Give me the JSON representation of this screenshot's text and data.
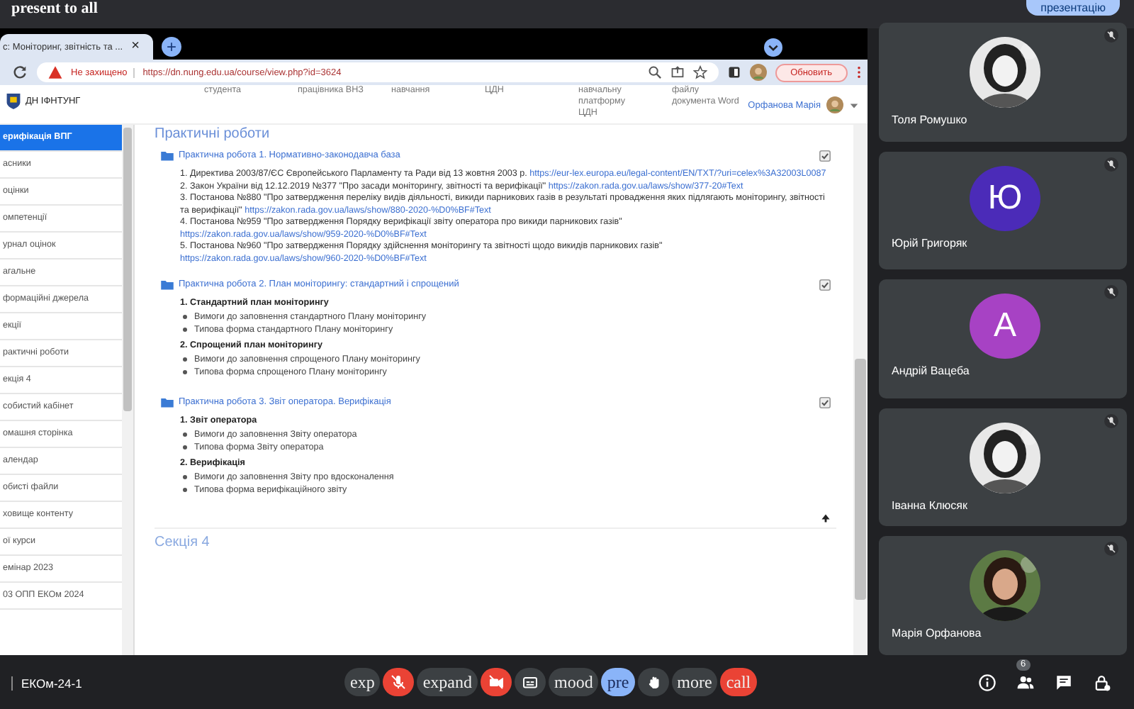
{
  "top_strip": {
    "text": "present to all",
    "button": "презентацію"
  },
  "browser": {
    "tab": {
      "title": "с: Моніторинг, звітність та ...",
      "close": "×"
    },
    "new_tab": "+",
    "security": "Не захищено",
    "url": "https://dn.nung.edu.ua/course/view.php?id=3624",
    "update_button": "Обновить"
  },
  "site": {
    "logo": "ДН ІФНТУНГ",
    "nav": [
      "студента",
      "працівника ВНЗ",
      "навчання",
      "ЦДН",
      "навчальну платформу ЦДН",
      "файлу документа Word"
    ],
    "user": "Орфанова Марія"
  },
  "sidebar": {
    "items": [
      {
        "label": "ерифікація ВПГ",
        "selected": true
      },
      {
        "label": "асники",
        "selected": false
      },
      {
        "label": "оцінки",
        "selected": false
      },
      {
        "label": "омпетенції",
        "selected": false
      },
      {
        "label": "урнал оцінок",
        "selected": false
      },
      {
        "label": "агальне",
        "selected": false
      },
      {
        "label": "формаційні джерела",
        "selected": false
      },
      {
        "label": "екції",
        "selected": false
      },
      {
        "label": "рактичні роботи",
        "selected": false
      },
      {
        "label": "екція 4",
        "selected": false
      },
      {
        "label": "собистий кабінет",
        "selected": false
      },
      {
        "label": "омашня сторінка",
        "selected": false
      },
      {
        "label": "алендар",
        "selected": false
      },
      {
        "label": "обисті файли",
        "selected": false
      },
      {
        "label": "ховище контенту",
        "selected": false
      },
      {
        "label": "ої курси",
        "selected": false
      },
      {
        "label": "емінар 2023",
        "selected": false
      },
      {
        "label": "03 ОПП ЕКОм 2024",
        "selected": false
      }
    ]
  },
  "content": {
    "section_title": "Практичні роботи",
    "activities": [
      {
        "title": "Практична робота 1. Нормативно-законодавча база",
        "checked": true,
        "kind": "links",
        "items": [
          {
            "text": "1. Директива 2003/87/ЄС Європейського Парламенту та Ради від 13 жовтня 2003 р.",
            "link": "https://eur-lex.europa.eu/legal-content/EN/TXT/?uri=celex%3A32003L0087"
          },
          {
            "text": "2. Закон України від 12.12.2019 №377 \"Про засади моніторингу, звітності та верифікації\"",
            "link": "https://zakon.rada.gov.ua/laws/show/377-20#Text"
          },
          {
            "text": "3. Постанова №880 \"Про затвердження переліку видів діяльності, викиди парникових газів в результаті провадження яких підлягають моніторингу, звітності та верифікації\"",
            "link": "https://zakon.rada.gov.ua/laws/show/880-2020-%D0%BF#Text"
          },
          {
            "text": "4. Постанова №959 \"Про затвердження Порядку верифікації звіту оператора про викиди парникових газів\"",
            "link": "https://zakon.rada.gov.ua/laws/show/959-2020-%D0%BF#Text"
          },
          {
            "text": "5. Постанова №960 \"Про затвердження Порядку здійснення моніторингу та звітності щодо викидів парникових газів\"",
            "link": "https://zakon.rada.gov.ua/laws/show/960-2020-%D0%BF#Text"
          }
        ]
      },
      {
        "title": "Практична робота 2. План моніторингу: стандартний і спрощений",
        "checked": true,
        "kind": "groups",
        "groups": [
          {
            "heading": "1. Стандартний план моніторингу",
            "bullets": [
              "Вимоги до заповнення стандартного Плану моніторингу",
              "Типова форма стандартного Плану моніторингу"
            ]
          },
          {
            "heading": "2. Спрощений план моніторингу",
            "bullets": [
              "Вимоги до заповнення спрощеного Плану моніторингу",
              "Типова форма спрощеного Плану моніторингу"
            ]
          }
        ]
      },
      {
        "title": "Практична робота 3. Звіт оператора. Верифікація",
        "checked": true,
        "kind": "groups",
        "groups": [
          {
            "heading": "1. Звіт оператора",
            "bullets": [
              "Вимоги до заповнення Звіту оператора",
              "Типова форма Звіту оператора"
            ]
          },
          {
            "heading": "2. Верифікація",
            "bullets": [
              "Вимоги до заповнення Звіту про вдосконалення",
              "Типова форма верифікаційного звіту"
            ]
          }
        ]
      }
    ],
    "next_section": "Секція 4"
  },
  "participants": [
    {
      "name": "Толя Ромушко",
      "kind": "picture",
      "muted": true
    },
    {
      "name": "Юрій Григоряк",
      "kind": "letter",
      "letter": "Ю",
      "color": "#4b2bb8",
      "muted": true
    },
    {
      "name": "Андрій Вацеба",
      "kind": "letter",
      "letter": "А",
      "color": "#a742c4",
      "muted": true
    },
    {
      "name": "Іванна Клюсяк",
      "kind": "picture",
      "muted": true
    },
    {
      "name": "Марія Орфанова",
      "kind": "picture",
      "muted": true
    }
  ],
  "bottom_bar": {
    "meeting": "ЕКОм-24-1",
    "controls": [
      {
        "kind": "text",
        "label": "exp",
        "color": "#3c4043"
      },
      {
        "kind": "mic",
        "color": "#ea4335"
      },
      {
        "kind": "text",
        "label": "expand",
        "color": "#3c4043"
      },
      {
        "kind": "camera",
        "color": "#ea4335"
      },
      {
        "kind": "captions",
        "color": "#3c4043"
      },
      {
        "kind": "text",
        "label": "mood",
        "color": "#3c4043"
      },
      {
        "kind": "text",
        "label": "pre",
        "color": "#8ab4f8"
      },
      {
        "kind": "hand",
        "color": "#3c4043"
      },
      {
        "kind": "text",
        "label": "more",
        "color": "#3c4043"
      },
      {
        "kind": "text",
        "label": "call",
        "color": "#ea4335"
      }
    ],
    "people_count": "6"
  }
}
